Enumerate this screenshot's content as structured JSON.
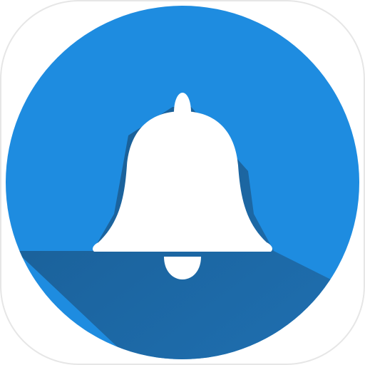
{
  "icon": {
    "name": "notification-bell-icon",
    "colors": {
      "tile": "#ffffff",
      "tile_border": "#e6e6e6",
      "circle": "#1e8ce0",
      "shadow": "#195c92",
      "bell": "#ffffff"
    }
  }
}
